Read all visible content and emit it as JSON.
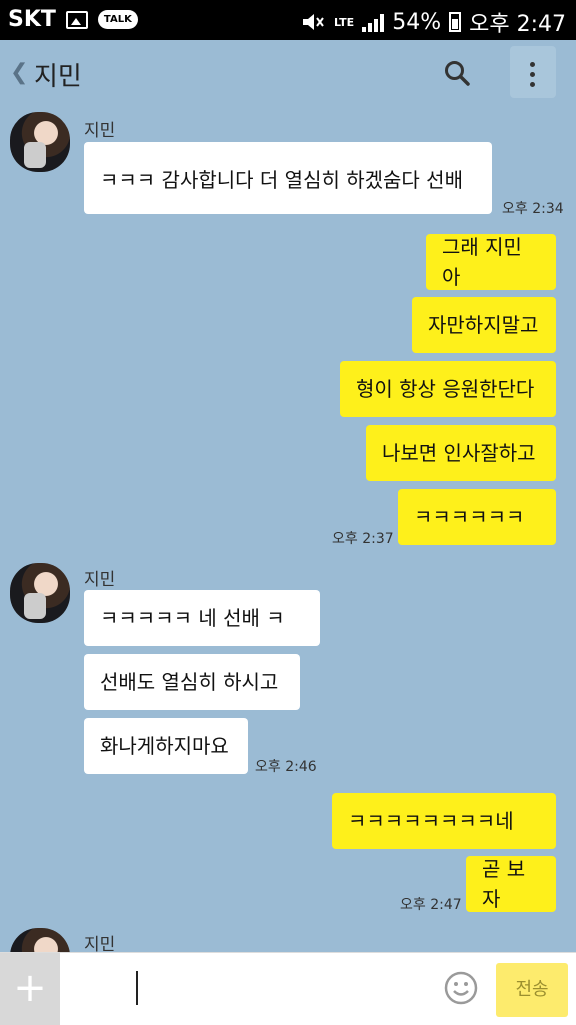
{
  "status_bar": {
    "carrier": "SKT",
    "talk_badge": "TALK",
    "network": "LTE",
    "battery": "54%",
    "time": "오후 2:47"
  },
  "header": {
    "back_glyph": "❮",
    "title": "지민"
  },
  "messages": {
    "sender_name": "지민",
    "m1": "ㅋㅋㅋ 감사합니다 더 열심히 하겠숨다 선배",
    "t1": "오후 2:34",
    "o1": "그래 지민아",
    "o2": "자만하지말고",
    "o3": "형이 항상 응원한단다",
    "o4": "나보면 인사잘하고",
    "o5": "ㅋㅋㅋㅋㅋㅋ",
    "t2": "오후 2:37",
    "m2": "ㅋㅋㅋㅋㅋ 네 선배 ㅋ",
    "m3": "선배도 열심히 하시고",
    "m4": "화나게하지마요",
    "t3": "오후 2:46",
    "o6": "ㅋㅋㅋㅋㅋㅋㅋㅋ네",
    "o7": "곧 보자",
    "t4": "오후 2:47"
  },
  "input_bar": {
    "plus": "+",
    "send_label": "전송"
  },
  "colors": {
    "chat_background": "#9bbbd4",
    "outgoing_bubble": "#fef01b",
    "incoming_bubble": "#ffffff"
  },
  "icons": [
    "back-arrow-icon",
    "search-icon",
    "menu-icon",
    "plus-icon",
    "emoji-icon"
  ]
}
